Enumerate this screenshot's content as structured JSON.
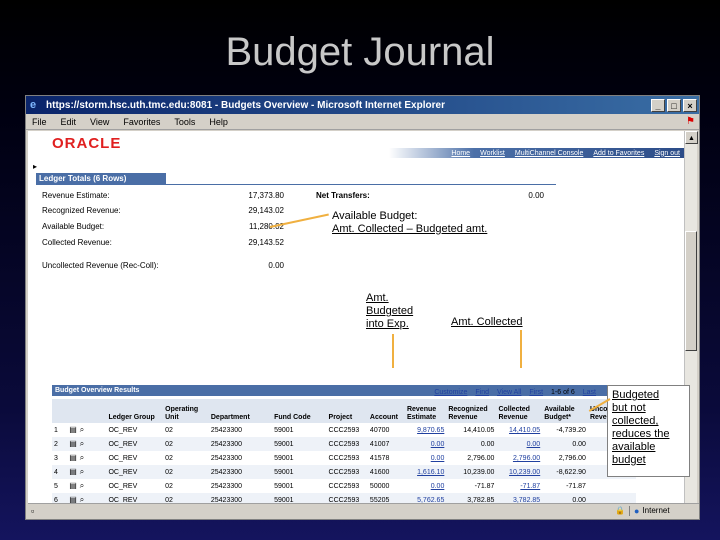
{
  "slide": {
    "title": "Budget Journal"
  },
  "browser": {
    "window_title": "https://storm.hsc.uth.tmc.edu:8081 - Budgets Overview - Microsoft Internet Explorer",
    "menu": [
      "File",
      "Edit",
      "View",
      "Favorites",
      "Tools",
      "Help"
    ],
    "status_zone": "Internet"
  },
  "app": {
    "logo": "ORACLE",
    "topnav": [
      "Home",
      "Worklist",
      "MultiChannel Console",
      "Add to Favorites",
      "Sign out"
    ],
    "ledger": {
      "header": "Ledger Totals (6 Rows)",
      "rows": [
        {
          "label": "Revenue Estimate:",
          "value": "17,373.80"
        },
        {
          "label": "Recognized Revenue:",
          "value": "29,143.02"
        },
        {
          "label": "Available Budget:",
          "value": "11,280.02"
        },
        {
          "label": "Collected Revenue:",
          "value": "29,143.52"
        },
        {
          "label": "Uncollected Revenue (Rec-Coll):",
          "value": "0.00"
        }
      ],
      "net_transfers_label": "Net Transfers:",
      "net_transfers_value": "0.00"
    },
    "grid": {
      "header": "Budget Overview Results",
      "nav": [
        "Customize",
        "Find",
        "View All",
        "First",
        "1-6 of 6",
        "Last"
      ],
      "columns": [
        "Ledger Group",
        "Operating Unit",
        "Department",
        "Fund Code",
        "Project",
        "Account",
        "Revenue Estimate",
        "Recognized Revenue",
        "Collected Revenue",
        "Available Budget*",
        "Uncollected Revenue"
      ],
      "rows": [
        {
          "num": "1",
          "ledger": "OC_REV",
          "unit": "02",
          "dept": "25423300",
          "fund": "59001",
          "project": "CCC2593",
          "account": "40700",
          "estimate": "9,870.65",
          "recognized": "14,410.05",
          "collected": "14,410.05",
          "available": "-4,739.20",
          "uncollected": ""
        },
        {
          "num": "2",
          "ledger": "OC_REV",
          "unit": "02",
          "dept": "25423300",
          "fund": "59001",
          "project": "CCC2593",
          "account": "41007",
          "estimate": "0.00",
          "recognized": "0.00",
          "collected": "0.00",
          "available": "0.00",
          "uncollected": ""
        },
        {
          "num": "3",
          "ledger": "OC_REV",
          "unit": "02",
          "dept": "25423300",
          "fund": "59001",
          "project": "CCC2593",
          "account": "41578",
          "estimate": "0.00",
          "recognized": "2,796.00",
          "collected": "2,796.00",
          "available": "2,796.00",
          "uncollected": ""
        },
        {
          "num": "4",
          "ledger": "OC_REV",
          "unit": "02",
          "dept": "25423300",
          "fund": "59001",
          "project": "CCC2593",
          "account": "41600",
          "estimate": "1,616.10",
          "recognized": "10,239.00",
          "collected": "10,239.00",
          "available": "-8,622.90",
          "uncollected": ""
        },
        {
          "num": "5",
          "ledger": "OC_REV",
          "unit": "02",
          "dept": "25423300",
          "fund": "59001",
          "project": "CCC2593",
          "account": "50000",
          "estimate": "0.00",
          "recognized": "-71.87",
          "collected": "-71.87",
          "available": "-71.87",
          "uncollected": ""
        },
        {
          "num": "6",
          "ledger": "OC_REV",
          "unit": "02",
          "dept": "25423300",
          "fund": "59001",
          "project": "CCC2593",
          "account": "55205",
          "estimate": "5,762.65",
          "recognized": "3,782.85",
          "collected": "3,782.85",
          "available": "0.00",
          "uncollected": ""
        }
      ]
    }
  },
  "callouts": {
    "available_title": "Available Budget:",
    "available_formula": "Amt. Collected – Budgeted amt.",
    "budgeted_line1": "Amt.",
    "budgeted_line2": "Budgeted",
    "budgeted_line3": "into Exp.",
    "collected": "Amt. Collected",
    "box_lines": [
      "Budgeted",
      "but not",
      "collected,",
      "reduces the",
      "available",
      "budget"
    ]
  },
  "colors": {
    "oracle_red": "#e02020",
    "header_blue": "#4a6ea6",
    "callout_arrow": "#f0b040"
  }
}
